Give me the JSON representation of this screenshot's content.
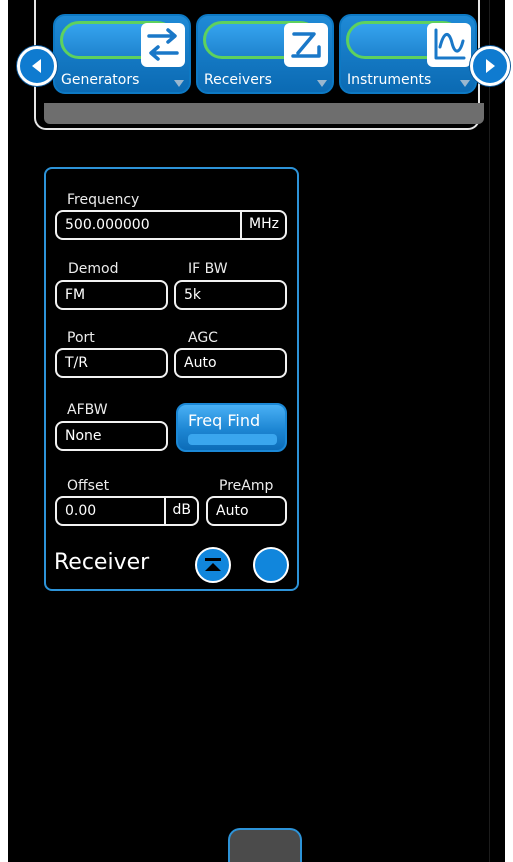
{
  "modules": [
    {
      "label": "Generators",
      "icon": "generators-arrows-icon"
    },
    {
      "label": "Receivers",
      "icon": "receivers-arrow-icon"
    },
    {
      "label": "Instruments",
      "icon": "instruments-waveform-icon"
    }
  ],
  "nav": {
    "prev_icon": "left-arrow-icon",
    "next_icon": "right-arrow-icon"
  },
  "receiver": {
    "title": "Receiver",
    "frequency": {
      "label": "Frequency",
      "value": "500.000000",
      "unit": "MHz"
    },
    "demod": {
      "label": "Demod",
      "value": "FM"
    },
    "if_bw": {
      "label": "IF BW",
      "value": "5k"
    },
    "port": {
      "label": "Port",
      "value": "T/R"
    },
    "agc": {
      "label": "AGC",
      "value": "Auto"
    },
    "afbw": {
      "label": "AFBW",
      "value": "None"
    },
    "freq_find_label": "Freq Find",
    "offset": {
      "label": "Offset",
      "value": "0.00",
      "unit": "dB"
    },
    "preamp": {
      "label": "PreAmp",
      "value": "Auto"
    }
  },
  "colors": {
    "accent": "#1186dc",
    "active_glow": "#5ed15e",
    "background": "#000000"
  }
}
